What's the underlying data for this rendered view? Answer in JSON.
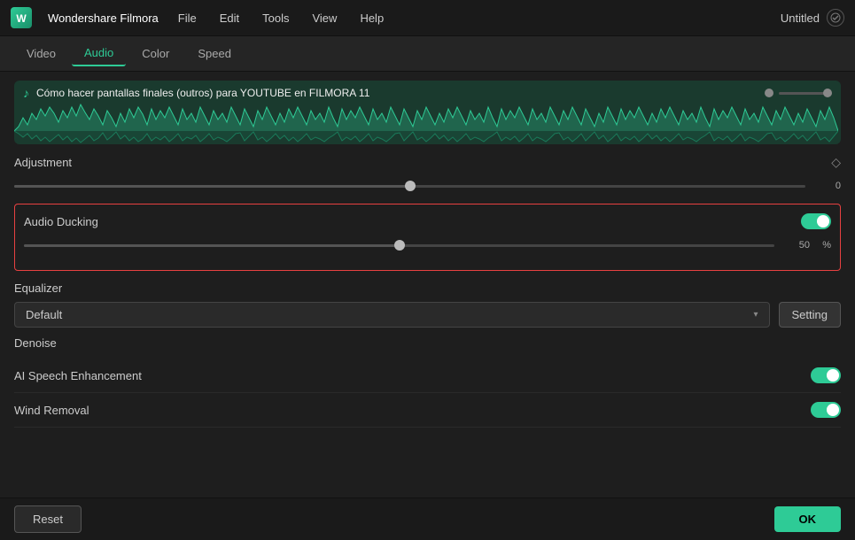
{
  "titleBar": {
    "appName": "Wondershare Filmora",
    "menuItems": [
      "File",
      "Edit",
      "Tools",
      "View",
      "Help"
    ],
    "projectTitle": "Untitled"
  },
  "tabs": [
    {
      "label": "Video",
      "active": false
    },
    {
      "label": "Audio",
      "active": true
    },
    {
      "label": "Color",
      "active": false
    },
    {
      "label": "Speed",
      "active": false
    }
  ],
  "waveform": {
    "trackTitle": "Cómo hacer pantallas finales (outros) para YOUTUBE en FILMORA 11"
  },
  "adjustment": {
    "sectionTitle": "Adjustment",
    "slider": {
      "value": "0",
      "thumbPosition": 50
    }
  },
  "audioDucking": {
    "sectionTitle": "Audio Ducking",
    "enabled": true,
    "slider": {
      "value": "50",
      "unit": "%",
      "thumbPosition": 50
    }
  },
  "equalizer": {
    "sectionTitle": "Equalizer",
    "selectedOption": "Default",
    "settingLabel": "Setting"
  },
  "denoise": {
    "sectionTitle": "Denoise"
  },
  "aiSpeechEnhancement": {
    "label": "AI Speech Enhancement",
    "enabled": true
  },
  "windRemoval": {
    "label": "Wind Removal",
    "enabled": true
  },
  "bottomBar": {
    "resetLabel": "Reset",
    "okLabel": "OK"
  }
}
